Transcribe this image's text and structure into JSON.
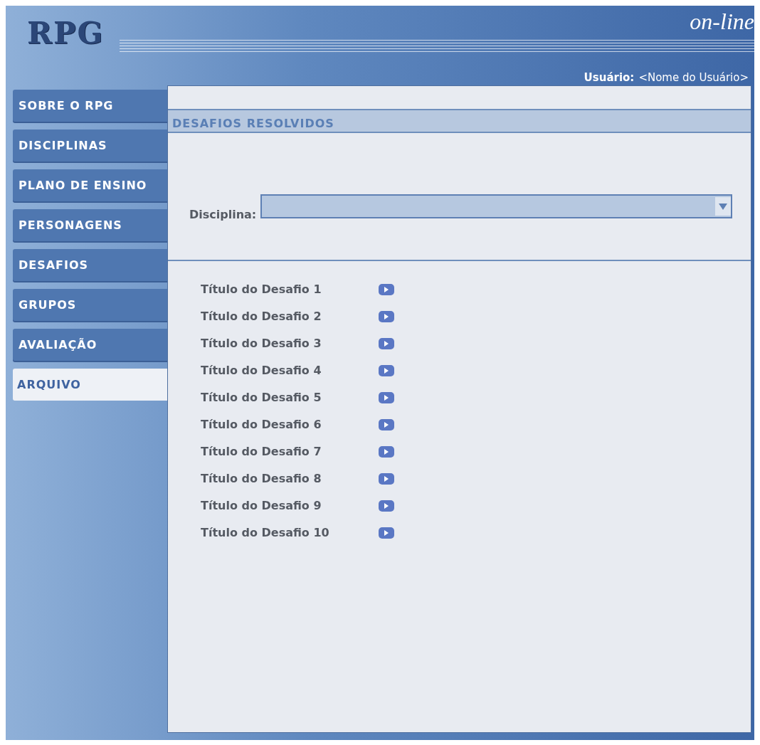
{
  "header": {
    "logo": "RPG",
    "tagline": "on-line",
    "user_label": "Usuário:",
    "user_name": "<Nome do Usuário>"
  },
  "menu": [
    {
      "label": "SOBRE O RPG",
      "selected": false
    },
    {
      "label": "DISCIPLINAS",
      "selected": false
    },
    {
      "label": "PLANO DE ENSINO",
      "selected": false
    },
    {
      "label": "PERSONAGENS",
      "selected": false
    },
    {
      "label": "DESAFIOS",
      "selected": false
    },
    {
      "label": "GRUPOS",
      "selected": false
    },
    {
      "label": "AVALIAÇÃO",
      "selected": false
    },
    {
      "label": "ARQUIVO",
      "selected": true
    }
  ],
  "section_title": "DESAFIOS RESOLVIDOS",
  "filter": {
    "label": "Disciplina:"
  },
  "challenges": [
    "Título do Desafio 1",
    "Título do Desafio 2",
    "Título do Desafio 3",
    "Título do Desafio 4",
    "Título do Desafio 5",
    "Título do Desafio 6",
    "Título do Desafio 7",
    "Título do Desafio 8",
    "Título do Desafio 9",
    "Título do Desafio 10"
  ]
}
